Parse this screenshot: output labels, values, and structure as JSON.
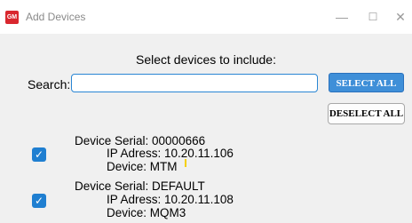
{
  "window": {
    "title": "Add Devices",
    "app_icon_text": "GM",
    "minimize_glyph": "—",
    "maximize_glyph": "☐",
    "close_glyph": "✕"
  },
  "dialog": {
    "prompt": "Select devices to include:",
    "search_label": "Search:",
    "search_value": "",
    "select_all_label": "SELECT ALL",
    "deselect_all_label": "DESELECT ALL"
  },
  "devices": [
    {
      "checked": true,
      "serial": "Device Serial: 00000666",
      "ip": "IP Adress: 10.20.11.106",
      "device": "Device: MTM"
    },
    {
      "checked": true,
      "serial": "Device Serial: DEFAULT",
      "ip": "IP Adress: 10.20.11.108",
      "device": "Device: MQM3"
    }
  ],
  "colors": {
    "accent": "#1f7fd1",
    "app_icon": "#d9272e"
  }
}
